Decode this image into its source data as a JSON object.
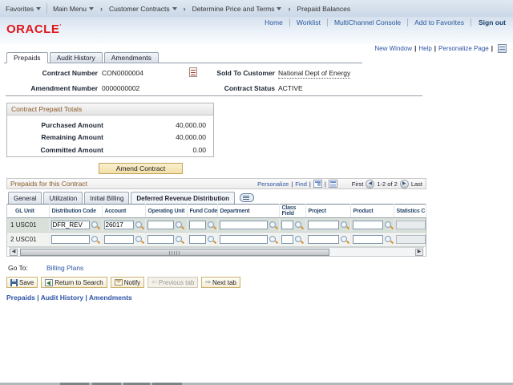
{
  "breadcrumb": {
    "favorites": "Favorites",
    "main_menu": "Main Menu",
    "crumbs": [
      "Customer Contracts",
      "Determine Price and Terms",
      "Prepaid Balances"
    ]
  },
  "header": {
    "brand": "ORACLE",
    "links": [
      "Home",
      "Worklist",
      "MultiChannel Console",
      "Add to Favorites"
    ],
    "sign_out": "Sign out"
  },
  "utility": {
    "new_window": "New Window",
    "help": "Help",
    "personalize_page": "Personalize Page"
  },
  "page_tabs": {
    "prepaids": "Prepaids",
    "audit_history": "Audit History",
    "amendments": "Amendments"
  },
  "fields": {
    "contract_number_label": "Contract Number",
    "contract_number": "CON0000004",
    "amendment_number_label": "Amendment Number",
    "amendment_number": "0000000002",
    "sold_to_label": "Sold To Customer",
    "sold_to": "National Dept of Energy",
    "status_label": "Contract Status",
    "status": "ACTIVE"
  },
  "totals": {
    "title": "Contract Prepaid Totals",
    "rows": [
      {
        "label": "Purchased Amount",
        "value": "40,000.00"
      },
      {
        "label": "Remaining Amount",
        "value": "40,000.00"
      },
      {
        "label": "Committed Amount",
        "value": "0.00"
      }
    ]
  },
  "amend_button": "Amend Contract",
  "grid": {
    "title": "Prepaids for this Contract",
    "personalize": "Personalize",
    "find": "Find",
    "pagination": {
      "first": "First",
      "range": "1-2 of 2",
      "last": "Last"
    },
    "tabs": [
      "General",
      "Utilization",
      "Initial Billing",
      "Deferred Revenue Distribution"
    ],
    "columns": [
      "GL Unit",
      "Distribution Code",
      "Account",
      "Operating Unit",
      "Fund Code",
      "Department",
      "Class Field",
      "Project",
      "Product",
      "Statistics C"
    ],
    "rows": [
      {
        "num": "1",
        "gl": "USC01",
        "dist": "DFR_REV",
        "acct": "26017",
        "oper": "",
        "fund": "",
        "dept": "",
        "cls": "",
        "proj": "",
        "prod": "",
        "stat": ""
      },
      {
        "num": "2",
        "gl": "USC01",
        "dist": "",
        "acct": "",
        "oper": "",
        "fund": "",
        "dept": "",
        "cls": "",
        "proj": "",
        "prod": "",
        "stat": ""
      }
    ]
  },
  "goto": {
    "label": "Go To:",
    "link": "Billing Plans"
  },
  "toolbar": {
    "save": "Save",
    "return_to_search": "Return to Search",
    "notify": "Notify",
    "previous_tab": "Previous tab",
    "next_tab": "Next tab"
  },
  "footer_links": {
    "prepaids": "Prepaids",
    "audit_history": "Audit History",
    "amendments": "Amendments"
  },
  "colors": {
    "accent_brown": "#8a5a28",
    "link_blue": "#2e54a5",
    "oracle_red": "#e0171e"
  }
}
